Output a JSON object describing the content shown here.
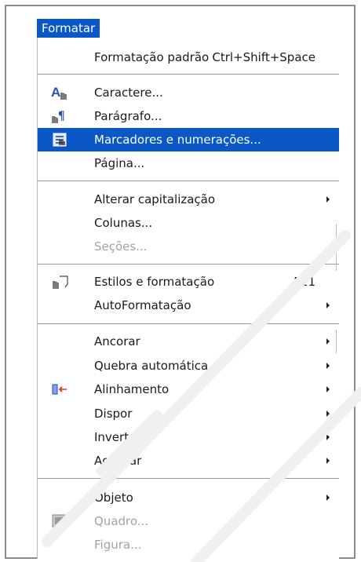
{
  "menubar": {
    "title": "Formatar"
  },
  "menu": {
    "items": [
      {
        "label": "Formatação padrão",
        "accel": "Ctrl+Shift+Space"
      },
      {
        "label": "Caractere..."
      },
      {
        "label": "Parágrafo..."
      },
      {
        "label": "Marcadores e numerações..."
      },
      {
        "label": "Página..."
      },
      {
        "label": "Alterar capitalização"
      },
      {
        "label": "Colunas..."
      },
      {
        "label": "Seções..."
      },
      {
        "label": "Estilos e formatação",
        "accel": "F11"
      },
      {
        "label": "AutoFormatação"
      },
      {
        "label": "Ancorar"
      },
      {
        "label": "Quebra automática"
      },
      {
        "label": "Alinhamento"
      },
      {
        "label": "Dispor"
      },
      {
        "label": "Inverter"
      },
      {
        "label": "Agrupar"
      },
      {
        "label": "Objeto"
      },
      {
        "label": "Quadro..."
      },
      {
        "label": "Figura..."
      }
    ]
  },
  "icons": {
    "character": "character-icon",
    "paragraph": "paragraph-icon",
    "bullets": "bullets-numbering-icon",
    "styles": "styles-formatting-icon",
    "alignment": "alignment-icon",
    "frame": "frame-icon"
  },
  "colors": {
    "highlight": "#0a58c8",
    "disabled": "#a3a3a3",
    "accent_red": "#d42a2a"
  }
}
